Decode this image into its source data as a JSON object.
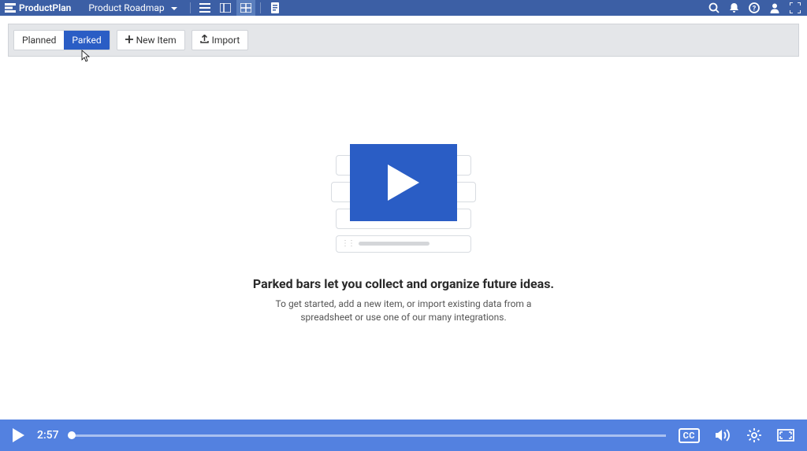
{
  "header": {
    "brand": "ProductPlan",
    "project": "Product Roadmap"
  },
  "toolbar": {
    "tabs": {
      "planned": "Planned",
      "parked": "Parked"
    },
    "new_item": "New Item",
    "import": "Import"
  },
  "empty_state": {
    "title": "Parked bars let you collect and organize future ideas.",
    "subtitle": "To get started, add a new item, or import existing data from a spreadsheet or use one of our many integrations."
  },
  "video": {
    "time": "2:57",
    "cc": "CC"
  }
}
